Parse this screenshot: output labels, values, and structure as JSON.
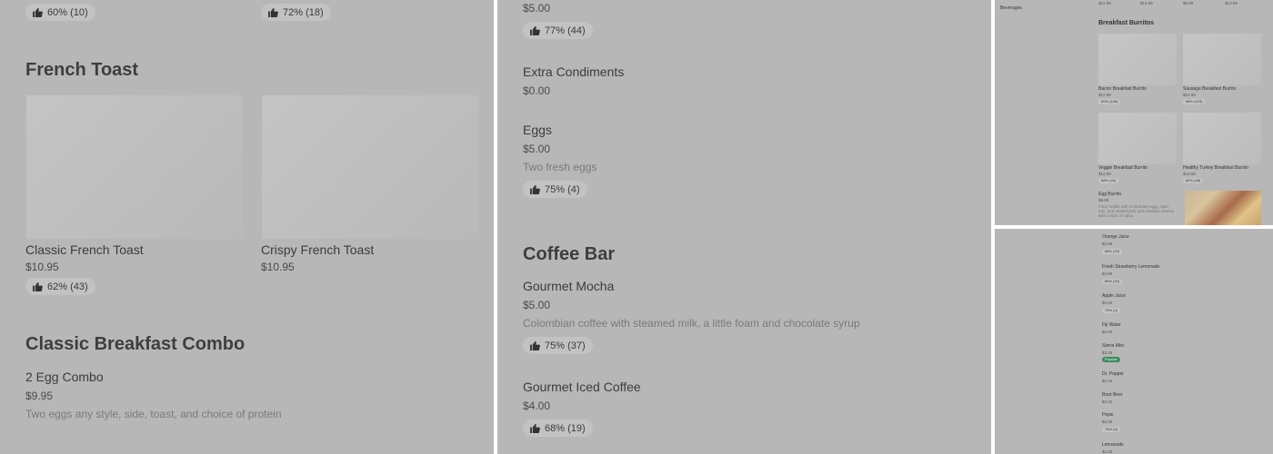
{
  "panel1": {
    "top_ratings": [
      "60% (10)",
      "72% (18)"
    ],
    "french_toast": {
      "heading": "French Toast",
      "items": [
        {
          "name": "Classic French Toast",
          "price": "$10.95",
          "rating": "62% (43)"
        },
        {
          "name": "Crispy French Toast",
          "price": "$10.95"
        }
      ]
    },
    "combo": {
      "heading": "Classic Breakfast Combo",
      "item": {
        "name": "2 Egg Combo",
        "price": "$9.95",
        "desc": "Two eggs any style, side, toast, and choice of protein"
      }
    }
  },
  "panel2": {
    "top_price": "$5.00",
    "top_rating": "77% (44)",
    "extra": {
      "name": "Extra Condiments",
      "price": "$0.00"
    },
    "eggs": {
      "name": "Eggs",
      "price": "$5.00",
      "desc": "Two fresh eggs",
      "rating": "75% (4)"
    },
    "coffee": {
      "heading": "Coffee Bar",
      "items": [
        {
          "name": "Gourmet Mocha",
          "price": "$5.00",
          "desc": "Colombian coffee with steamed milk, a little foam and chocolate syrup",
          "rating": "75% (37)"
        },
        {
          "name": "Gourmet Iced Coffee",
          "price": "$4.00",
          "rating": "68% (19)"
        }
      ]
    }
  },
  "panel3": {
    "sidebar_label": "Beverages",
    "top_prices": [
      "$12.99",
      "$12.99",
      "$9.99",
      "$13.99"
    ],
    "heading": "Breakfast Burritos",
    "items": [
      {
        "name": "Bacon Breakfast Burrito",
        "price": "$12.99",
        "rating": "60% (106)"
      },
      {
        "name": "Sausage Breakfast Burrito",
        "price": "$12.99",
        "rating": "88% (103)"
      },
      {
        "name": "Veggie Breakfast Burrito",
        "price": "$12.99",
        "rating": "88% (20)"
      },
      {
        "name": "Healthy Turkey Breakfast Burrito",
        "price": "$13.99",
        "rating": "82% (28)"
      },
      {
        "name": "Egg Burrito",
        "price": "$9.99",
        "desc": "Flour tortilla with scrambled eggs, tater tots, and melted jack and cheddar cheese with a side of salsa"
      }
    ]
  },
  "panel4": {
    "items": [
      {
        "name": "Orange Juice",
        "price": "$3.99",
        "rating": "88% (20)"
      },
      {
        "name": "Fresh Strawberry Lemonade",
        "price": "$3.99",
        "rating": "86% (20)"
      },
      {
        "name": "Apple Juice",
        "price": "$3.50",
        "rating": "75% (4)"
      },
      {
        "name": "Fiji Water",
        "price": "$3.00"
      },
      {
        "name": "Sierra Mist",
        "price": "$3.25",
        "badge": "Popular"
      },
      {
        "name": "Dr. Pepper",
        "price": "$3.25"
      },
      {
        "name": "Root Beer",
        "price": "$3.25"
      },
      {
        "name": "Pepsi",
        "price": "$3.25",
        "rating": "75% (4)"
      },
      {
        "name": "Lemonade",
        "price": "$3.25"
      }
    ]
  }
}
